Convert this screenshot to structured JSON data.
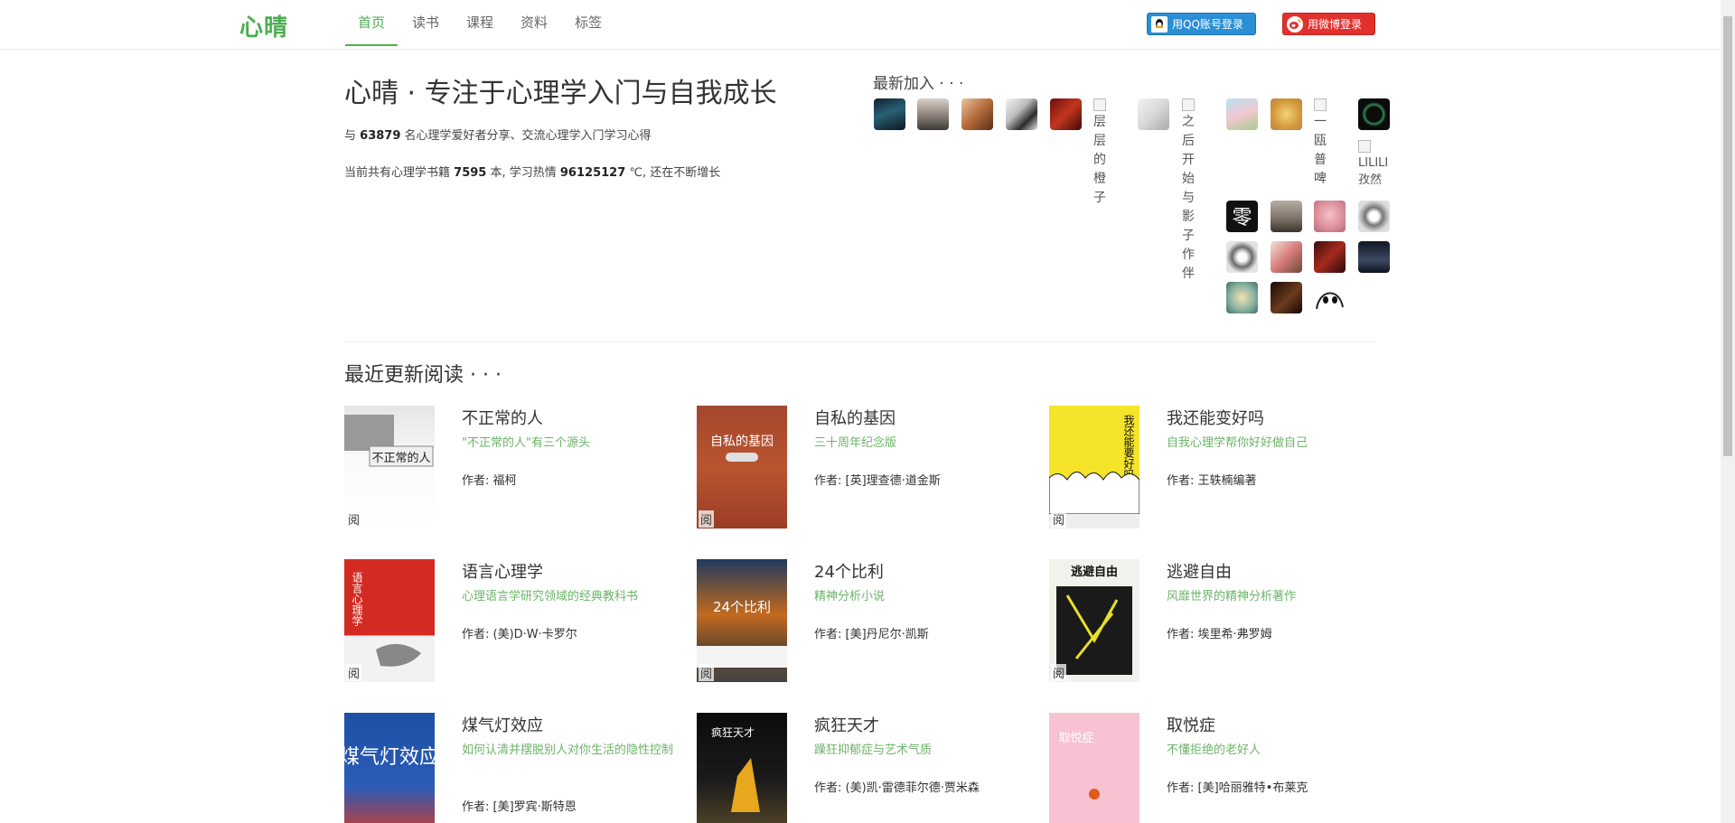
{
  "brand": "心晴",
  "nav": [
    "首页",
    "读书",
    "课程",
    "资料",
    "标签"
  ],
  "login": {
    "qq": "用QQ账号登录",
    "weibo": "用微博登录"
  },
  "intro": {
    "title": "心晴 · 专注于心理学入门与自我成长",
    "line1_prefix": "与",
    "members": "63879",
    "line1_suffix": "名心理学爱好者分享、交流心理学入门学习心得",
    "line2_prefix": "当前共有心理学书籍",
    "books": "7595",
    "line2_mid": "本, 学习热情",
    "heat": "96125127",
    "line2_suffix": "℃, 还在不断增长"
  },
  "newest": {
    "title": "最新加入 · · ·",
    "broken_names": [
      "层层的橙子",
      "之后开始与影子作伴",
      "一瓯普啤",
      "LILILI孜然"
    ]
  },
  "recent": {
    "title": "最近更新阅读 · · ·",
    "read_tag": "阅",
    "author_label": "作者: ",
    "books": [
      {
        "title": "不正常的人",
        "subtitle": "\"不正常的人\"有三个源头",
        "author": "福柯"
      },
      {
        "title": "自私的基因",
        "subtitle": "三十周年纪念版",
        "author": "[英]理查德·道金斯"
      },
      {
        "title": "我还能变好吗",
        "subtitle": "自我心理学帮你好好做自己",
        "author": "王轶楠编著"
      },
      {
        "title": "语言心理学",
        "subtitle": "心理语言学研究领域的经典教科书",
        "author": "(美)D·W·卡罗尔"
      },
      {
        "title": "24个比利",
        "subtitle": "精神分析小说",
        "author": "[美]丹尼尔·凯斯"
      },
      {
        "title": "逃避自由",
        "subtitle": "风靡世界的精神分析著作",
        "author": "埃里希·弗罗姆"
      },
      {
        "title": "煤气灯效应",
        "subtitle": "如何认清并摆脱别人对你生活的隐性控制",
        "author": "[美]罗宾·斯特恩"
      },
      {
        "title": "疯狂天才",
        "subtitle": "躁狂抑郁症与艺术气质",
        "author": "(美)凯·雷德菲尔德·贾米森"
      },
      {
        "title": "取悦症",
        "subtitle": "不懂拒绝的老好人",
        "author": "[美]哈丽雅特•布莱克"
      }
    ],
    "covers": {
      "c0": "不正常的人",
      "c1": "自私的基因",
      "c2": "我还能要好吗",
      "c3": "语言心理学",
      "c4": "24个比利",
      "c5": "逃避自由",
      "c6": "煤气灯效应",
      "c7": "疯狂天才",
      "c8": "取悦症"
    }
  },
  "colors": {
    "accent": "#4caf50",
    "subtitle": "#6cb468",
    "qq": "#2b8fd6",
    "weibo": "#e2302d"
  }
}
